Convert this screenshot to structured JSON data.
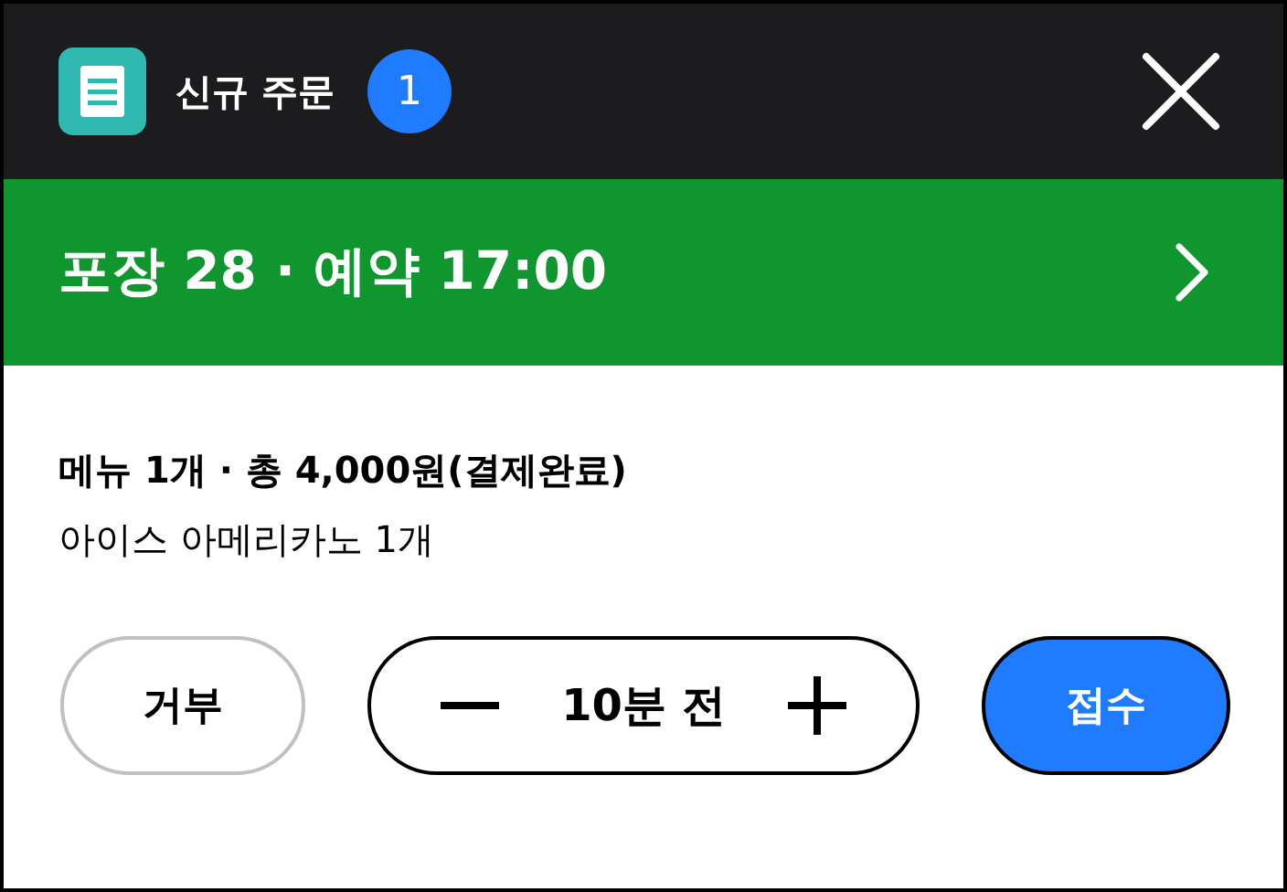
{
  "header": {
    "title": "신규 주문",
    "badge": "1"
  },
  "order_bar": {
    "title": "포장 28 · 예약 17:00"
  },
  "summary": {
    "line": "메뉴 1개 · 총 4,000원(결제완료)",
    "items": [
      "아이스 아메리카노 1개"
    ]
  },
  "actions": {
    "reject": "거부",
    "time": "10분 전",
    "accept": "접수"
  }
}
